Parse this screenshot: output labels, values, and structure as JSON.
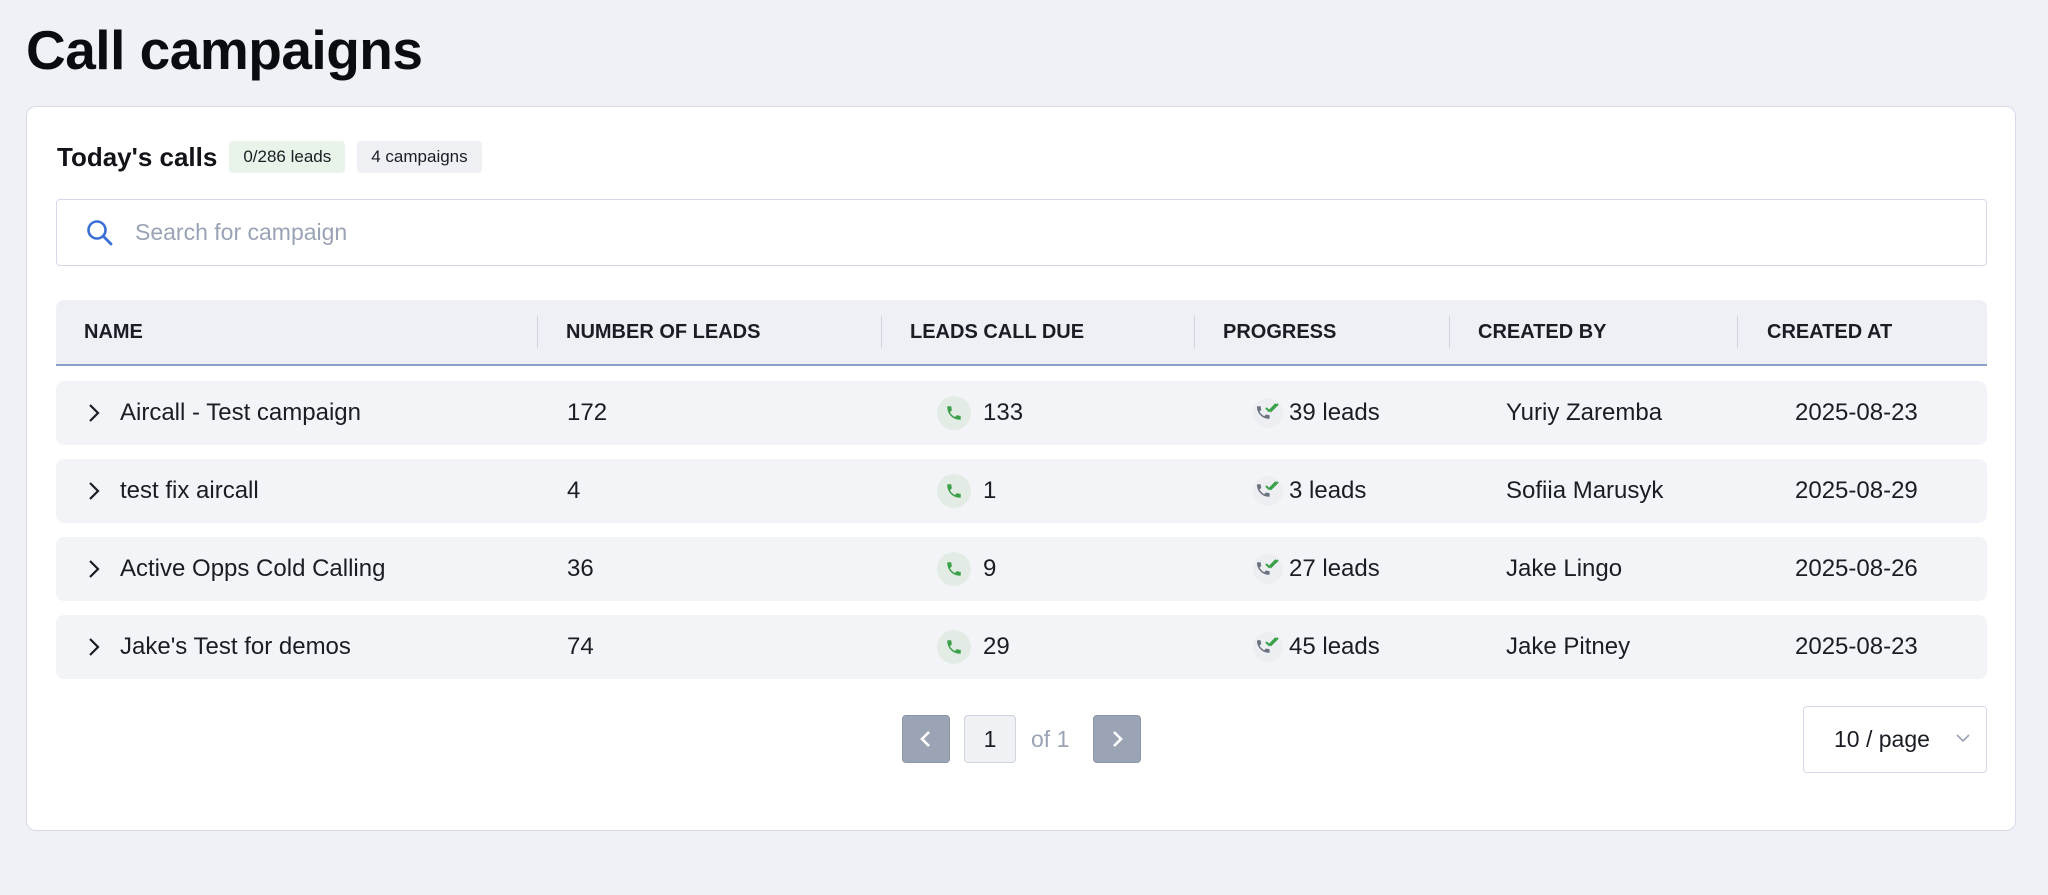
{
  "page": {
    "title": "Call campaigns"
  },
  "card": {
    "title": "Today's calls",
    "leads_badge": "0/286 leads",
    "campaigns_badge": "4 campaigns"
  },
  "search": {
    "placeholder": "Search for campaign",
    "value": ""
  },
  "table": {
    "columns": [
      "NAME",
      "NUMBER OF LEADS",
      "LEADS CALL DUE",
      "PROGRESS",
      "CREATED BY",
      "CREATED AT"
    ],
    "rows": [
      {
        "name": "Aircall - Test campaign",
        "leads": "172",
        "due": "133",
        "progress": "39 leads",
        "created_by": "Yuriy Zaremba",
        "created_at": "2025-08-23"
      },
      {
        "name": "test fix aircall",
        "leads": "4",
        "due": "1",
        "progress": "3 leads",
        "created_by": "Sofiia Marusyk",
        "created_at": "2025-08-29"
      },
      {
        "name": "Active Opps Cold Calling",
        "leads": "36",
        "due": "9",
        "progress": "27 leads",
        "created_by": "Jake Lingo",
        "created_at": "2025-08-26"
      },
      {
        "name": "Jake's Test for demos",
        "leads": "74",
        "due": "29",
        "progress": "45 leads",
        "created_by": "Jake Pitney",
        "created_at": "2025-08-23"
      }
    ]
  },
  "pagination": {
    "current": "1",
    "of_label": "of 1",
    "page_size": "10 / page"
  },
  "icons": {
    "search": "search-icon",
    "expand": "chevron-right-icon",
    "phone": "phone-icon",
    "progress": "phone-check-icon",
    "prev": "chevron-left-icon",
    "next": "chevron-right-icon",
    "dropdown": "chevron-down-icon"
  },
  "colors": {
    "background": "#eff1f6",
    "card": "#ffffff",
    "row": "#f3f4f8",
    "accent_blue": "#3b6fd8",
    "phone_green": "#3aa14a",
    "pager_button": "#9aa4b4"
  }
}
